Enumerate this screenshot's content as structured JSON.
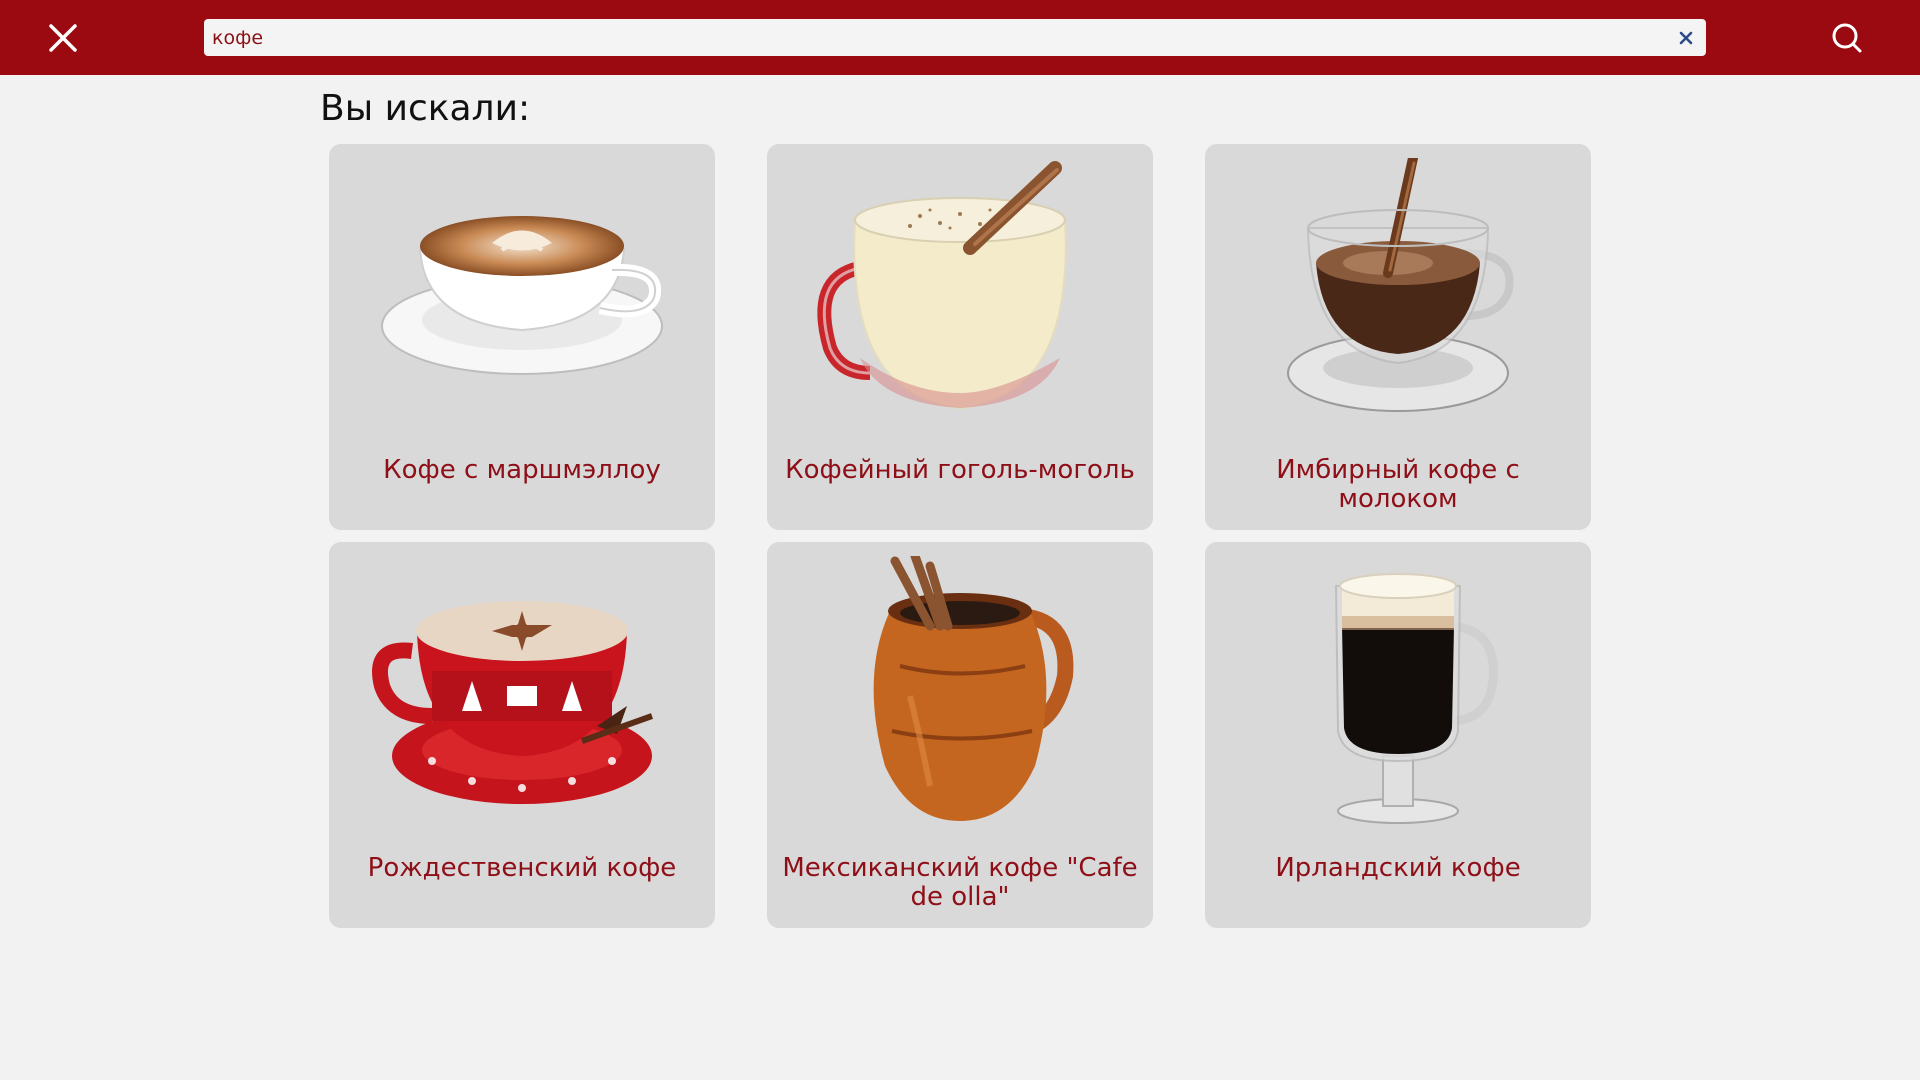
{
  "header": {
    "search": {
      "value": "кофе",
      "placeholder": ""
    },
    "icons": {
      "close": "close-icon",
      "clear": "clear-x-icon",
      "search": "search-icon"
    }
  },
  "results": {
    "title": "Вы искали:",
    "items": [
      {
        "title": "Кофе с маршмэллоу",
        "image": "cappuccino-cup-image"
      },
      {
        "title": "Кофейный гоголь-моголь",
        "image": "eggnog-glass-image"
      },
      {
        "title": "Имбирный кофе с молоком",
        "image": "glass-cup-coffee-image"
      },
      {
        "title": "Рождественский кофе",
        "image": "red-christmas-cup-image"
      },
      {
        "title": "Мексиканский кофе \"Cafe de olla\"",
        "image": "clay-pot-coffee-image"
      },
      {
        "title": "Ирландский кофе",
        "image": "irish-coffee-glass-image"
      }
    ]
  },
  "colors": {
    "header_bg": "#9b0a10",
    "page_bg": "#f2f2f2",
    "card_bg": "#d9d9d9",
    "card_title": "#8e0f17",
    "clear_icon": "#2c4a8a"
  }
}
